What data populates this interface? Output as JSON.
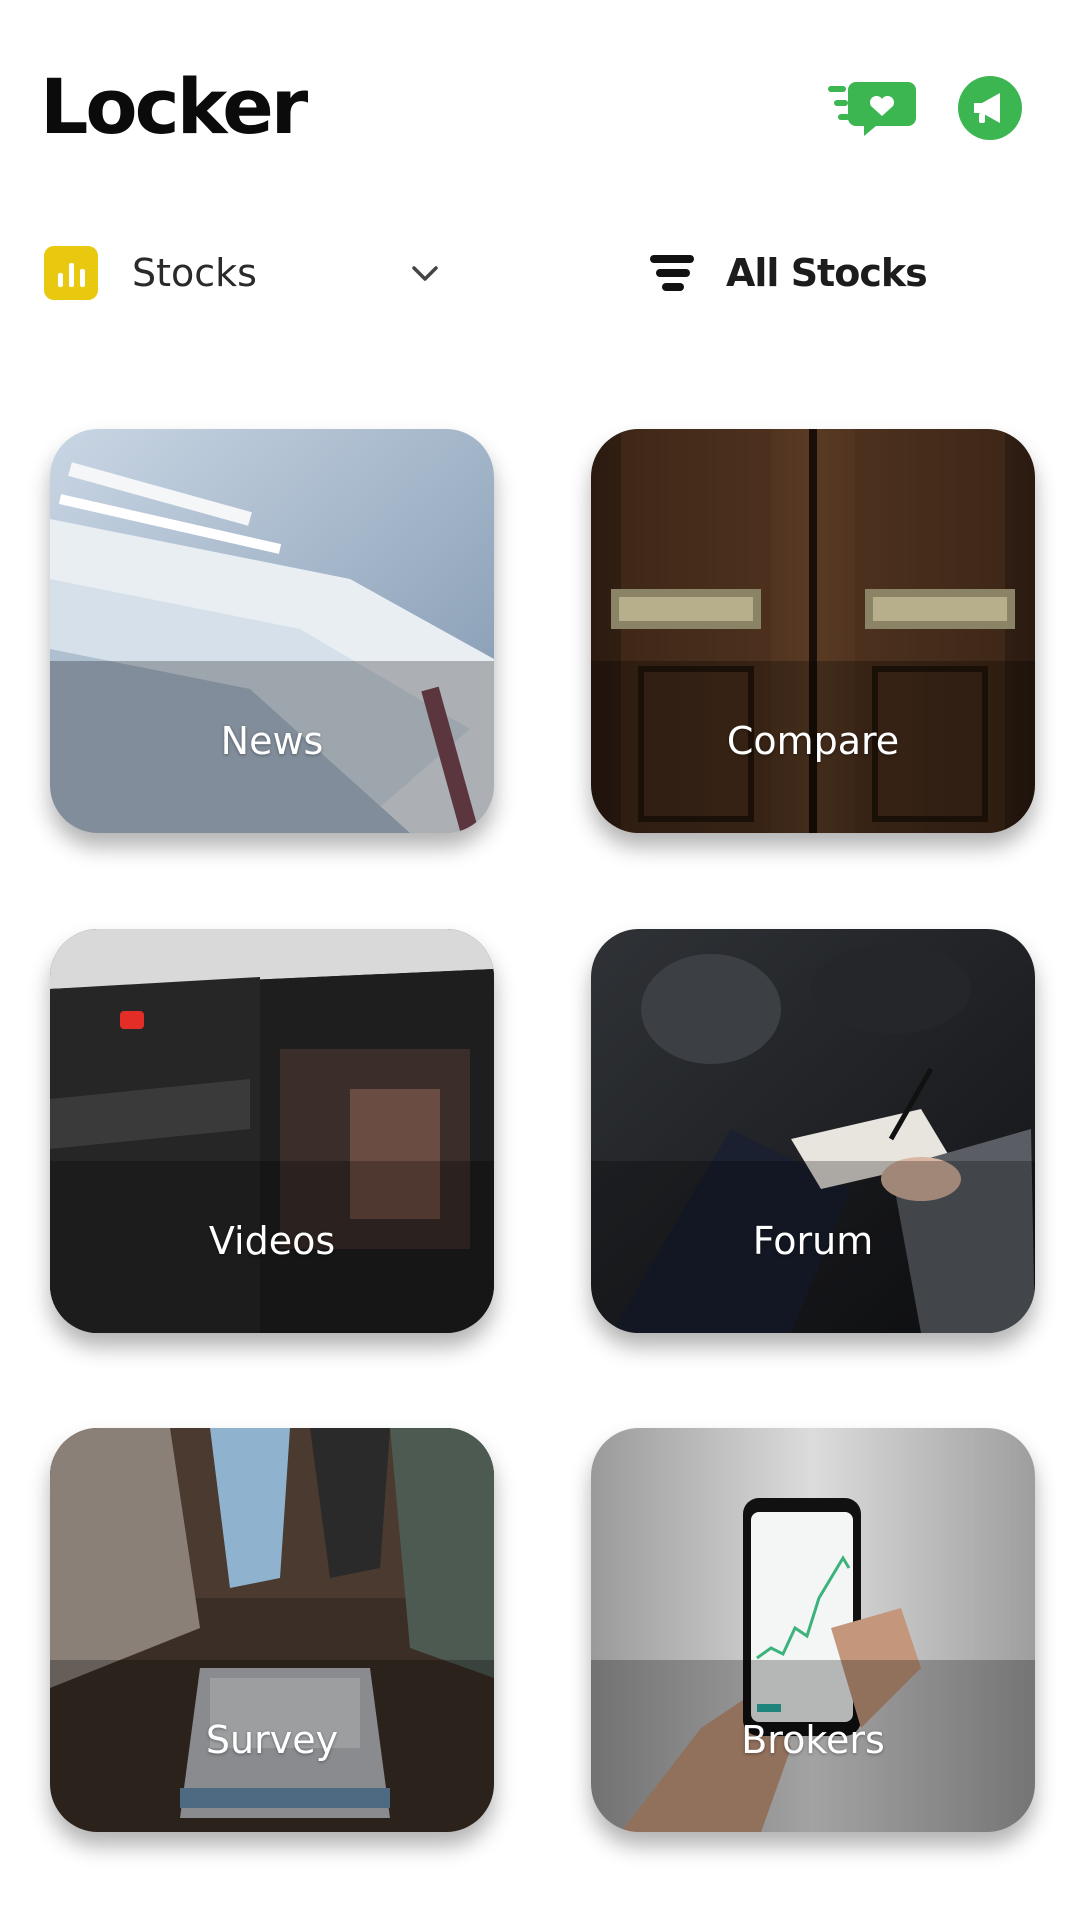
{
  "header": {
    "title": "Locker",
    "accent_color": "#3cb650",
    "feedback_icon": "chat-heart-icon",
    "announce_icon": "megaphone-icon"
  },
  "filters": {
    "category_label": "Stocks",
    "category_icon": "bar-chart-icon",
    "category_icon_color": "#e8c90f",
    "scope_label": "All Stocks",
    "scope_icon": "sort-lines-icon"
  },
  "tiles": [
    {
      "label": "News"
    },
    {
      "label": "Compare"
    },
    {
      "label": "Videos"
    },
    {
      "label": "Forum"
    },
    {
      "label": "Survey"
    },
    {
      "label": "Brokers"
    }
  ]
}
